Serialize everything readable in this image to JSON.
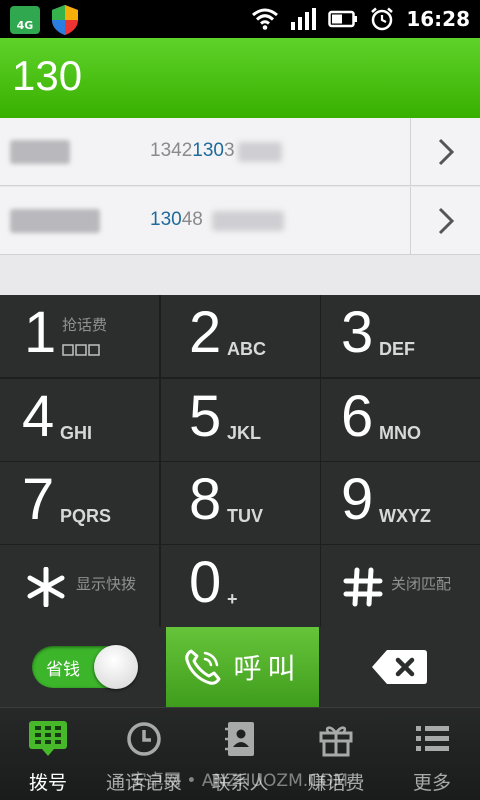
{
  "status_bar": {
    "network_badge": "4G",
    "time": "16:28"
  },
  "dial_input": {
    "value": "130"
  },
  "results": [
    {
      "phone_prefix": "1342",
      "phone_match": "130",
      "phone_suffix": "3"
    },
    {
      "phone_prefix": "",
      "phone_match": "130",
      "phone_suffix": "48"
    }
  ],
  "keypad": {
    "keys": [
      {
        "digit": "1",
        "letters": "",
        "extra": "抢话费"
      },
      {
        "digit": "2",
        "letters": "ABC"
      },
      {
        "digit": "3",
        "letters": "DEF"
      },
      {
        "digit": "4",
        "letters": "GHI"
      },
      {
        "digit": "5",
        "letters": "JKL"
      },
      {
        "digit": "6",
        "letters": "MNO"
      },
      {
        "digit": "7",
        "letters": "PQRS"
      },
      {
        "digit": "8",
        "letters": "TUV"
      },
      {
        "digit": "9",
        "letters": "WXYZ"
      },
      {
        "digit": "*",
        "extra": "显示快拨"
      },
      {
        "digit": "0",
        "letters": "+"
      },
      {
        "digit": "#",
        "extra": "关闭匹配"
      }
    ]
  },
  "actions": {
    "save_toggle_label": "省钱",
    "call_label": "呼叫"
  },
  "tabs": [
    {
      "label": "拨号",
      "icon": "dialpad-icon",
      "active": true
    },
    {
      "label": "通话记录",
      "icon": "clock-icon",
      "active": false
    },
    {
      "label": "联系人",
      "icon": "contacts-book-icon",
      "active": false
    },
    {
      "label": "赚话费",
      "icon": "gift-icon",
      "active": false
    },
    {
      "label": "更多",
      "icon": "list-icon",
      "active": false
    }
  ],
  "watermark": "安卓网 • ANZHUOZM.COM",
  "colors": {
    "header_green": "#38b000",
    "call_green": "#4fae27",
    "keypad_bg": "#2b2e2d",
    "highlight_blue": "#1f6a9a"
  }
}
